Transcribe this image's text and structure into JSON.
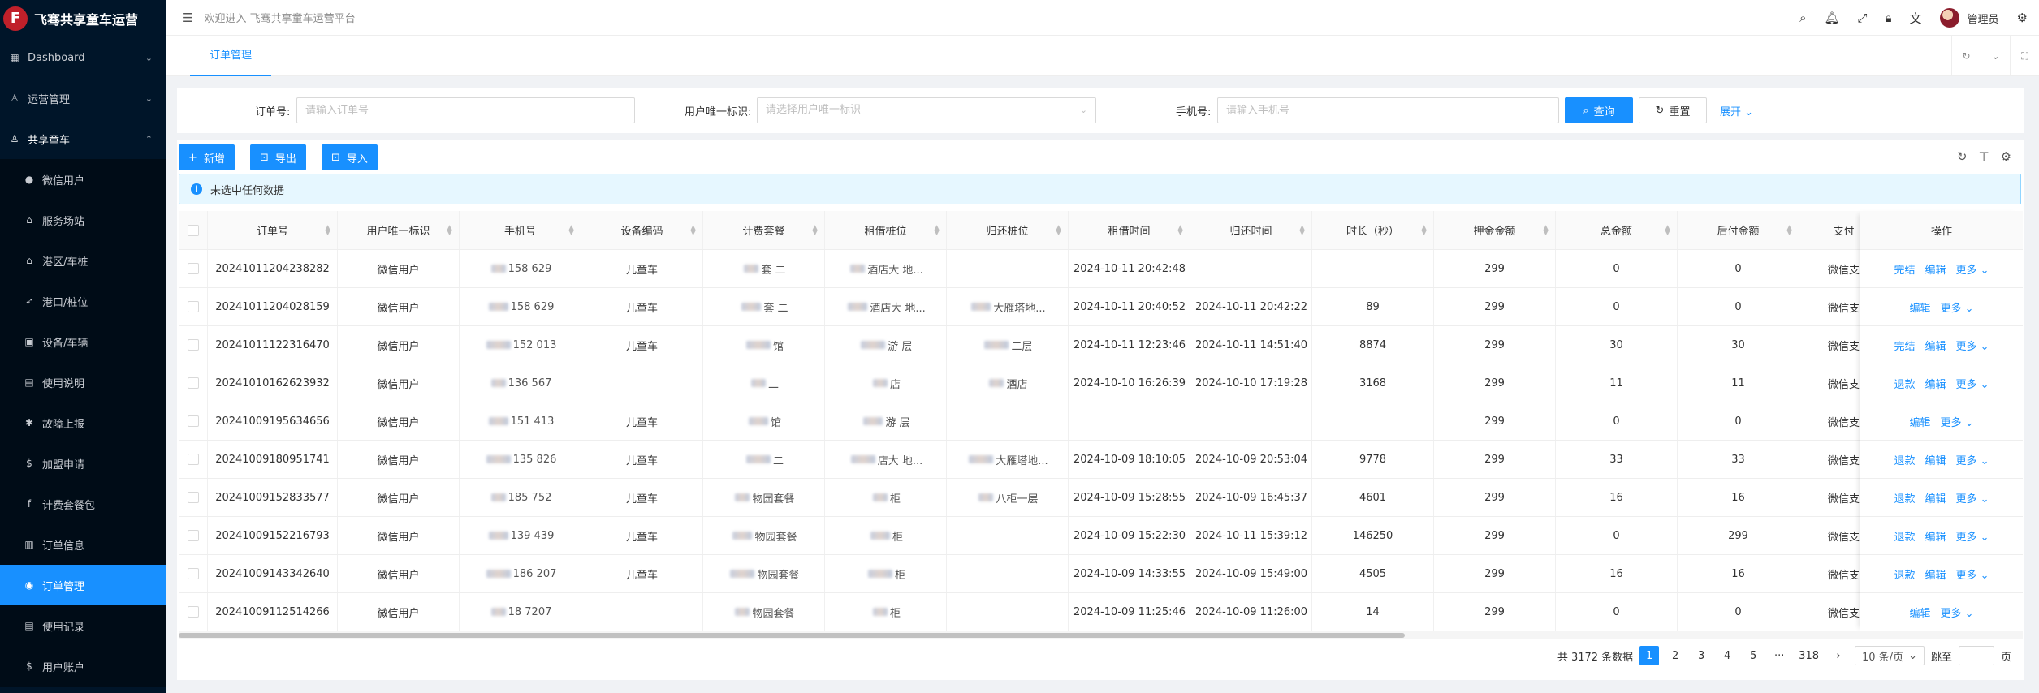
{
  "app": {
    "logo_letter": "F",
    "title": "飞骞共享童车运营"
  },
  "header": {
    "welcome": "欢迎进入 飞骞共享童车运营平台",
    "user": "管理员"
  },
  "sidebar": {
    "top_items": [
      {
        "label": "Dashboard",
        "icon": "dashboard-icon"
      },
      {
        "label": "运营管理",
        "icon": "user-icon"
      }
    ],
    "group": {
      "label": "共享童车",
      "icon": "user-icon"
    },
    "sub_items": [
      {
        "label": "微信用户",
        "icon": "wechat-icon"
      },
      {
        "label": "服务场站",
        "icon": "bank-icon"
      },
      {
        "label": "港区/车桩",
        "icon": "bank-icon"
      },
      {
        "label": "港口/桩位",
        "icon": "rocket-icon"
      },
      {
        "label": "设备/车辆",
        "icon": "car-icon"
      },
      {
        "label": "使用说明",
        "icon": "file-icon"
      },
      {
        "label": "故障上报",
        "icon": "bug-icon"
      },
      {
        "label": "加盟申请",
        "icon": "dollar-icon"
      },
      {
        "label": "计费套餐包",
        "icon": "facebook-icon"
      },
      {
        "label": "订单信息",
        "icon": "order-icon"
      },
      {
        "label": "订单管理",
        "icon": "order-manage-icon"
      },
      {
        "label": "使用记录",
        "icon": "file-icon"
      },
      {
        "label": "用户账户",
        "icon": "dollar-icon"
      }
    ]
  },
  "tabs": {
    "active": "订单管理"
  },
  "search": {
    "order_label": "订单号:",
    "order_placeholder": "请输入订单号",
    "uid_label": "用户唯一标识:",
    "uid_placeholder": "请选择用户唯一标识",
    "phone_label": "手机号:",
    "phone_placeholder": "请输入手机号",
    "query": "查询",
    "reset": "重置",
    "expand": "展开"
  },
  "toolbar": {
    "add": "新增",
    "export": "导出",
    "import": "导入"
  },
  "alert": "未选中任何数据",
  "table": {
    "columns": [
      "订单号",
      "用户唯一标识",
      "手机号",
      "设备编码",
      "计费套餐",
      "租借桩位",
      "归还桩位",
      "租借时间",
      "归还时间",
      "时长（秒）",
      "押金金额",
      "总金额",
      "后付金额",
      "支付"
    ],
    "ops_header": "操作",
    "rows": [
      {
        "order": "20241011204238282",
        "uid": "微信用户",
        "phone": "158  629",
        "device": "儿童车",
        "plan": "套 二",
        "rent_pos": "酒店大 地...",
        "return_pos": "",
        "rent_time": "2024-10-11 20:42:48",
        "return_time": "",
        "dur": "",
        "deposit": "299",
        "total": "0",
        "post": "0",
        "pay": "微信支",
        "ops": [
          "完结",
          "编辑",
          "更多"
        ]
      },
      {
        "order": "20241011204028159",
        "uid": "微信用户",
        "phone": "158  629",
        "device": "儿童车",
        "plan": "套 二",
        "rent_pos": "酒店大 地...",
        "return_pos": "大雁塔地...",
        "rent_time": "2024-10-11 20:40:52",
        "return_time": "2024-10-11 20:42:22",
        "dur": "89",
        "deposit": "299",
        "total": "0",
        "post": "0",
        "pay": "微信支",
        "ops": [
          "编辑",
          "更多"
        ]
      },
      {
        "order": "20241011122316470",
        "uid": "微信用户",
        "phone": "152  013",
        "device": "儿童车",
        "plan": " 馆",
        "rent_pos": "游 层",
        "return_pos": "二层",
        "rent_time": "2024-10-11 12:23:46",
        "return_time": "2024-10-11 14:51:40",
        "dur": "8874",
        "deposit": "299",
        "total": "30",
        "post": "30",
        "pay": "微信支",
        "ops": [
          "完结",
          "编辑",
          "更多"
        ]
      },
      {
        "order": "20241010162623932",
        "uid": "微信用户",
        "phone": "136  567",
        "device": "",
        "plan": " 二",
        "rent_pos": " 店",
        "return_pos": "酒店",
        "rent_time": "2024-10-10 16:26:39",
        "return_time": "2024-10-10 17:19:28",
        "dur": "3168",
        "deposit": "299",
        "total": "11",
        "post": "11",
        "pay": "微信支",
        "ops": [
          "退款",
          "编辑",
          "更多"
        ]
      },
      {
        "order": "20241009195634656",
        "uid": "微信用户",
        "phone": "151  413",
        "device": "儿童车",
        "plan": " 馆",
        "rent_pos": "游 层",
        "return_pos": "",
        "rent_time": "",
        "return_time": "",
        "dur": "",
        "deposit": "299",
        "total": "0",
        "post": "0",
        "pay": "微信支",
        "ops": [
          "编辑",
          "更多"
        ]
      },
      {
        "order": "20241009180951741",
        "uid": "微信用户",
        "phone": "135  826",
        "device": "儿童车",
        "plan": " 二",
        "rent_pos": "店大 地...",
        "return_pos": "大雁塔地...",
        "rent_time": "2024-10-09 18:10:05",
        "return_time": "2024-10-09 20:53:04",
        "dur": "9778",
        "deposit": "299",
        "total": "33",
        "post": "33",
        "pay": "微信支",
        "ops": [
          "退款",
          "编辑",
          "更多"
        ]
      },
      {
        "order": "20241009152833577",
        "uid": "微信用户",
        "phone": "185  752",
        "device": "儿童车",
        "plan": "物园套餐",
        "rent_pos": " 柜 ",
        "return_pos": "八柜一层",
        "rent_time": "2024-10-09 15:28:55",
        "return_time": "2024-10-09 16:45:37",
        "dur": "4601",
        "deposit": "299",
        "total": "16",
        "post": "16",
        "pay": "微信支",
        "ops": [
          "退款",
          "编辑",
          "更多"
        ]
      },
      {
        "order": "20241009152216793",
        "uid": "微信用户",
        "phone": "139  439",
        "device": "儿童车",
        "plan": "物园套餐",
        "rent_pos": " 柜 ",
        "return_pos": "",
        "rent_time": "2024-10-09 15:22:30",
        "return_time": "2024-10-11 15:39:12",
        "dur": "146250",
        "deposit": "299",
        "total": "0",
        "post": "299",
        "pay": "微信支",
        "ops": [
          "退款",
          "编辑",
          "更多"
        ]
      },
      {
        "order": "20241009143342640",
        "uid": "微信用户",
        "phone": "186  207",
        "device": "儿童车",
        "plan": "物园套餐",
        "rent_pos": " 柜 ",
        "return_pos": "",
        "rent_time": "2024-10-09 14:33:55",
        "return_time": "2024-10-09 15:49:00",
        "dur": "4505",
        "deposit": "299",
        "total": "16",
        "post": "16",
        "pay": "微信支",
        "ops": [
          "退款",
          "编辑",
          "更多"
        ]
      },
      {
        "order": "20241009112514266",
        "uid": "微信用户",
        "phone": "18  7207",
        "device": "",
        "plan": "物园套餐",
        "rent_pos": " 柜 ",
        "return_pos": "",
        "rent_time": "2024-10-09 11:25:46",
        "return_time": "2024-10-09 11:26:00",
        "dur": "14",
        "deposit": "299",
        "total": "0",
        "post": "0",
        "pay": "微信支",
        "ops": [
          "编辑",
          "更多"
        ]
      }
    ]
  },
  "pagination": {
    "total_text": "共 3172 条数据",
    "pages": [
      "1",
      "2",
      "3",
      "4",
      "5"
    ],
    "ellipsis": "···",
    "last": "318",
    "page_size": "10 条/页",
    "jump_label": "跳至",
    "page_unit": "页"
  },
  "colors": {
    "primary": "#1890ff",
    "sidebar_bg": "#001529",
    "danger_logo": "#c0202a"
  }
}
